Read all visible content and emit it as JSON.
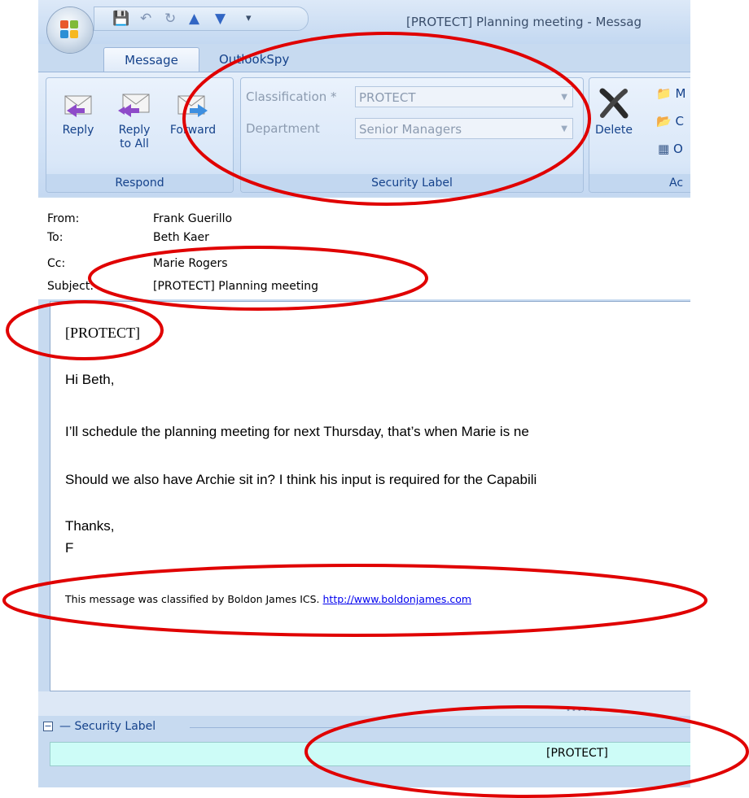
{
  "window": {
    "title": "[PROTECT] Planning meeting - Messag",
    "tabs": [
      {
        "label": "Message",
        "active": true
      },
      {
        "label": "OutlookSpy",
        "active": false
      }
    ]
  },
  "ribbon": {
    "respond": {
      "group_label": "Respond",
      "reply": "Reply",
      "reply_all_1": "Reply",
      "reply_all_2": "to All",
      "forward": "Forward"
    },
    "security_label": {
      "group_label": "Security Label",
      "classification_label": "Classification *",
      "classification_value": "PROTECT",
      "department_label": "Department",
      "department_value": "Senior Managers"
    },
    "actions": {
      "delete": "Delete",
      "group_label_partial": "Ac",
      "item1": "M",
      "item2": "C",
      "item3": "O"
    }
  },
  "header": {
    "from_label": "From:",
    "from": "Frank Guerillo",
    "to_label": "To:",
    "to": "Beth Kaer",
    "cc_label": "Cc:",
    "cc": "Marie Rogers",
    "subject_label": "Subject:",
    "subject": "[PROTECT] Planning meeting"
  },
  "body": {
    "marking": "[PROTECT]",
    "greeting": "Hi Beth,",
    "line1": "I’ll schedule the planning meeting for next Thursday, that’s when Marie is ne",
    "line2": "Should we also have Archie sit in? I think his input is required for the Capabili",
    "signoff": "Thanks,",
    "signature": "F",
    "footer_text": "This message was classified by Boldon James ICS.",
    "footer_link": "http://www.boldonjames.com"
  },
  "security_pane": {
    "header": "Security Label",
    "value": "[PROTECT]"
  },
  "colors": {
    "annotation": "#e00000",
    "ribbon_text": "#15428b",
    "security_bar": "#cdfcf7"
  }
}
